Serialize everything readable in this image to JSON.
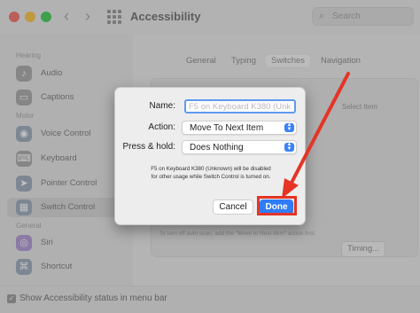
{
  "window": {
    "title": "Accessibility",
    "search_placeholder": "Search",
    "traffic_lights": [
      "#f25f57",
      "#f9bd2e",
      "#2bc840"
    ]
  },
  "sidebar": {
    "sections": [
      {
        "label": "Hearing",
        "items": [
          {
            "label": "Audio",
            "icon": "speaker-icon",
            "color": "#9e9e9e"
          },
          {
            "label": "Captions",
            "icon": "captions-icon",
            "color": "#9e9e9e"
          }
        ]
      },
      {
        "label": "Motor",
        "items": [
          {
            "label": "Voice Control",
            "icon": "voice-control-icon",
            "color": "#8fa0b3"
          },
          {
            "label": "Keyboard",
            "icon": "keyboard-icon",
            "color": "#9e9e9e"
          },
          {
            "label": "Pointer Control",
            "icon": "pointer-icon",
            "color": "#8fa0b3"
          },
          {
            "label": "Switch Control",
            "icon": "switch-control-icon",
            "color": "#8fa0b3",
            "selected": true
          }
        ]
      },
      {
        "label": "General",
        "items": [
          {
            "label": "Siri",
            "icon": "siri-icon",
            "color": "#a78bd0"
          },
          {
            "label": "Shortcut",
            "icon": "shortcut-icon",
            "color": "#8fa0b3"
          }
        ]
      }
    ]
  },
  "main": {
    "tabs": [
      "General",
      "Typing",
      "Switches",
      "Navigation"
    ],
    "active_tab": "Switches",
    "select_item_label": "Select Item",
    "hint_text": "To turn off auto scan, add the \"Move to Next Item\" action first.",
    "timing_button": "Timing..."
  },
  "footer": {
    "checkbox_label": "Show Accessibility status in menu bar",
    "checked": true
  },
  "dialog": {
    "name_label": "Name:",
    "name_placeholder": "F5 on Keyboard K380 (Unk",
    "action_label": "Action:",
    "action_value": "Move To Next Item",
    "press_hold_label": "Press & hold:",
    "press_hold_value": "Does Nothing",
    "note_lines": [
      "F5 on Keyboard K380 (Unknown) will be disabled",
      "for other usage while Switch Control is turned on."
    ],
    "cancel_label": "Cancel",
    "done_label": "Done"
  },
  "annotation": {
    "color": "#e53426"
  }
}
